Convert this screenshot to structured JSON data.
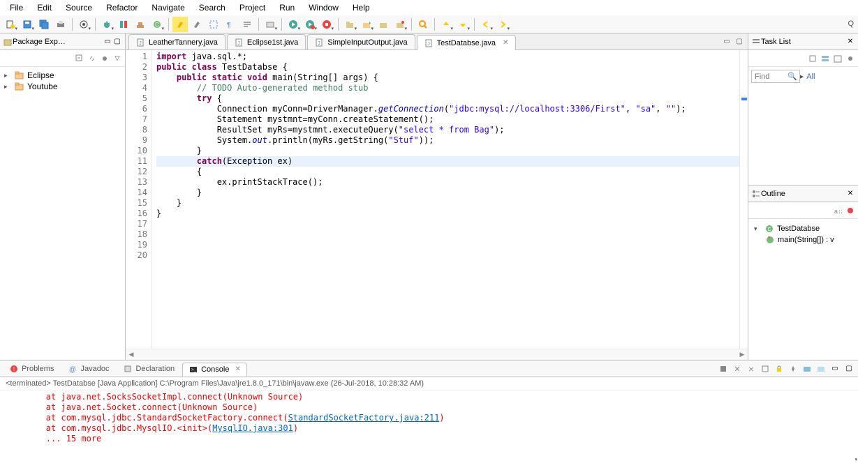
{
  "menu": [
    "File",
    "Edit",
    "Source",
    "Refactor",
    "Navigate",
    "Search",
    "Project",
    "Run",
    "Window",
    "Help"
  ],
  "quick": "Q",
  "packageExplorer": {
    "title": "Package Exp…",
    "items": [
      {
        "label": "Eclipse",
        "expandable": true
      },
      {
        "label": "Youtube",
        "expandable": true
      }
    ]
  },
  "editorTabs": [
    {
      "label": "LeatherTannery.java",
      "active": false
    },
    {
      "label": "Eclipse1st.java",
      "active": false
    },
    {
      "label": "SimpleInputOutput.java",
      "active": false
    },
    {
      "label": "TestDatabse.java",
      "active": true
    }
  ],
  "code": {
    "lines": [
      {
        "n": 1,
        "segs": [
          {
            "t": "import",
            "c": "kw"
          },
          {
            "t": " java.sql.*;"
          }
        ]
      },
      {
        "n": 2,
        "segs": [
          {
            "t": "public class",
            "c": "kw"
          },
          {
            "t": " TestDatabse {"
          }
        ]
      },
      {
        "n": 3,
        "segs": [
          {
            "t": ""
          }
        ]
      },
      {
        "n": 4,
        "segs": [
          {
            "t": "    "
          },
          {
            "t": "public static void",
            "c": "kw"
          },
          {
            "t": " main(String[] args) {"
          }
        ],
        "ann": "⊖"
      },
      {
        "n": 5,
        "segs": [
          {
            "t": "        "
          },
          {
            "t": "// TODO Auto-generated method stub",
            "c": "cm"
          }
        ]
      },
      {
        "n": 6,
        "segs": [
          {
            "t": "        "
          },
          {
            "t": "try",
            "c": "kw"
          },
          {
            "t": " {"
          }
        ]
      },
      {
        "n": 7,
        "segs": [
          {
            "t": ""
          }
        ]
      },
      {
        "n": 8,
        "segs": [
          {
            "t": "            Connection myConn=DriverManager."
          },
          {
            "t": "getConnection",
            "c": "fld"
          },
          {
            "t": "("
          },
          {
            "t": "\"jdbc:mysql://localhost:3306/First\"",
            "c": "str"
          },
          {
            "t": ", "
          },
          {
            "t": "\"sa\"",
            "c": "str"
          },
          {
            "t": ", "
          },
          {
            "t": "\"\"",
            "c": "str"
          },
          {
            "t": ");"
          }
        ]
      },
      {
        "n": 9,
        "segs": [
          {
            "t": "            Statement mystmnt=myConn.createStatement();"
          }
        ]
      },
      {
        "n": 10,
        "segs": [
          {
            "t": "            ResultSet myRs=mystmnt.executeQuery("
          },
          {
            "t": "\"select * from Bag\"",
            "c": "str"
          },
          {
            "t": ");"
          }
        ]
      },
      {
        "n": 11,
        "segs": [
          {
            "t": "            System."
          },
          {
            "t": "out",
            "c": "fld"
          },
          {
            "t": ".println(myRs.getString("
          },
          {
            "t": "\"Stuf\"",
            "c": "str"
          },
          {
            "t": "));"
          }
        ]
      },
      {
        "n": 12,
        "segs": [
          {
            "t": "        }"
          }
        ]
      },
      {
        "n": 13,
        "segs": [
          {
            "t": "        "
          },
          {
            "t": "catch",
            "c": "kw"
          },
          {
            "t": "(Exception ex)"
          }
        ],
        "hl": true
      },
      {
        "n": 14,
        "segs": [
          {
            "t": "        {"
          }
        ]
      },
      {
        "n": 15,
        "segs": [
          {
            "t": "            ex.printStackTrace();"
          }
        ]
      },
      {
        "n": 16,
        "segs": [
          {
            "t": "        }"
          }
        ]
      },
      {
        "n": 17,
        "segs": [
          {
            "t": "    }"
          }
        ]
      },
      {
        "n": 18,
        "segs": [
          {
            "t": ""
          }
        ]
      },
      {
        "n": 19,
        "segs": [
          {
            "t": "}"
          }
        ]
      },
      {
        "n": 20,
        "segs": [
          {
            "t": ""
          }
        ]
      }
    ]
  },
  "taskList": {
    "title": "Task List",
    "findPlaceholder": "Find",
    "all": "All"
  },
  "outline": {
    "title": "Outline",
    "root": "TestDatabse",
    "method": "main(String[]) : v"
  },
  "bottomTabs": [
    {
      "label": "Problems",
      "active": false
    },
    {
      "label": "Javadoc",
      "active": false
    },
    {
      "label": "Declaration",
      "active": false
    },
    {
      "label": "Console",
      "active": true
    }
  ],
  "console": {
    "desc": "<terminated> TestDatabse [Java Application] C:\\Program Files\\Java\\jre1.8.0_171\\bin\\javaw.exe (26-Jul-2018, 10:28:32 AM)",
    "lines": [
      {
        "indent": "        ",
        "pre": "at java.net.SocksSocketImpl.connect(Unknown Source)",
        "link": ""
      },
      {
        "indent": "        ",
        "pre": "at java.net.Socket.connect(Unknown Source)",
        "link": ""
      },
      {
        "indent": "        ",
        "pre": "at com.mysql.jdbc.StandardSocketFactory.connect(",
        "link": "StandardSocketFactory.java:211",
        "post": ")"
      },
      {
        "indent": "        ",
        "pre": "at com.mysql.jdbc.MysqlIO.<init>(",
        "link": "MysqlIO.java:301",
        "post": ")"
      },
      {
        "indent": "        ",
        "pre": "... 15 more",
        "link": ""
      }
    ]
  }
}
